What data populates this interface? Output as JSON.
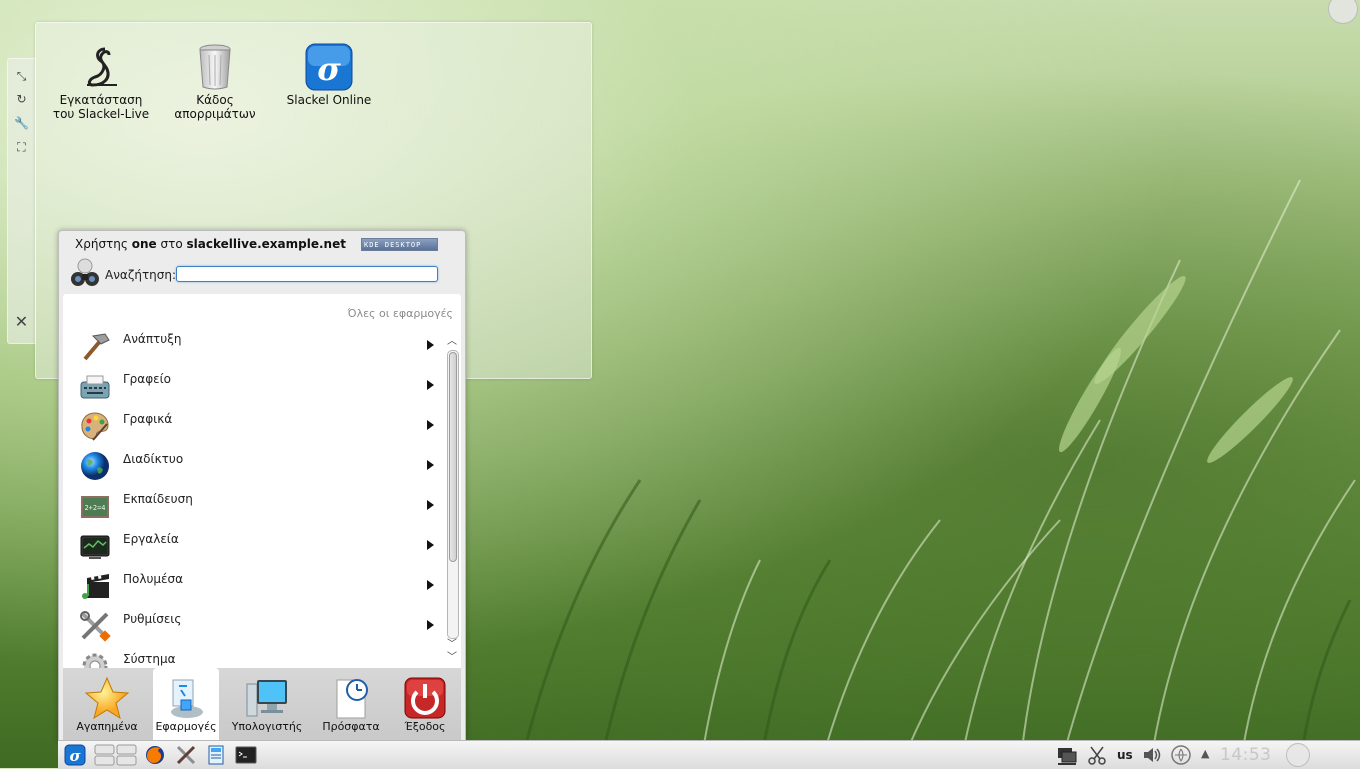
{
  "desktop": {
    "icons": [
      {
        "label": "Εγκατάσταση\nτου Slackel-Live",
        "icon": "slackel-install-icon"
      },
      {
        "label": "Κάδος\nαπορριμάτων",
        "icon": "trash-icon"
      },
      {
        "label": "Slackel Online",
        "icon": "slackel-online-icon"
      }
    ]
  },
  "kickoff": {
    "user_prefix": "Χρήστης",
    "user_name": "one",
    "user_mid": "στο",
    "host": "slackellive.example.net",
    "badge": "KDE DESKTOP",
    "search_label": "Αναζήτηση:",
    "search_value": "",
    "list_title": "Όλες οι εφαρμογές",
    "items": [
      {
        "label": "Ανάπτυξη",
        "icon": "hammer-icon"
      },
      {
        "label": "Γραφείο",
        "icon": "typewriter-icon"
      },
      {
        "label": "Γραφικά",
        "icon": "palette-icon"
      },
      {
        "label": "Διαδίκτυο",
        "icon": "globe-icon"
      },
      {
        "label": "Εκπαίδευση",
        "icon": "chalkboard-icon"
      },
      {
        "label": "Εργαλεία",
        "icon": "monitor-tool-icon"
      },
      {
        "label": "Πολυμέσα",
        "icon": "clapper-icon"
      },
      {
        "label": "Ρυθμίσεις",
        "icon": "tools-icon"
      },
      {
        "label": "Σύστημα",
        "icon": "gear-icon"
      }
    ],
    "tabs": [
      {
        "label": "Αγαπημένα",
        "icon": "star-icon"
      },
      {
        "label": "Εφαρμογές",
        "icon": "applications-icon"
      },
      {
        "label": "Υπολογιστής",
        "icon": "computer-icon"
      },
      {
        "label": "Πρόσφατα",
        "icon": "recent-clock-icon"
      },
      {
        "label": "Έξοδος",
        "icon": "power-icon"
      }
    ],
    "active_tab": "Εφαρμογές"
  },
  "panel": {
    "keyboard_layout": "us",
    "clock": "14:53"
  },
  "colors": {
    "accent": "#3c7fc6",
    "logout_red": "#c62828"
  }
}
